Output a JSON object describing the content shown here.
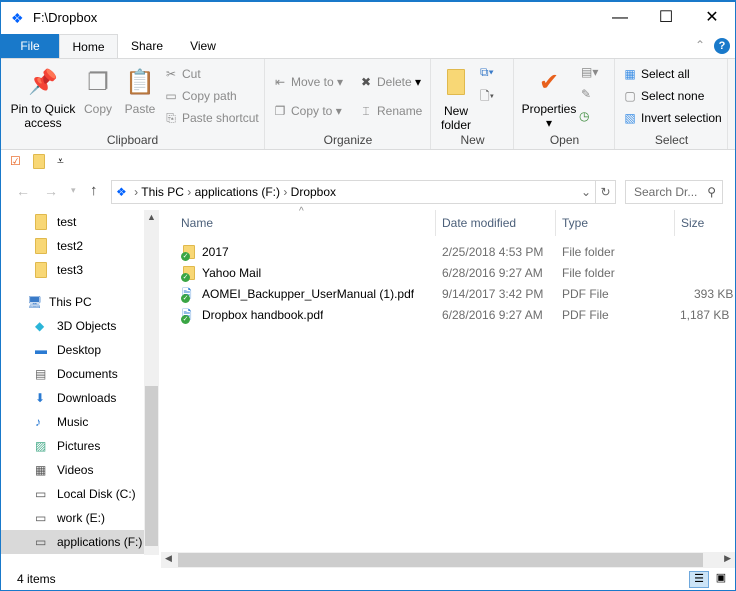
{
  "window": {
    "title": "F:\\Dropbox",
    "minimize": "—",
    "maximize": "☐",
    "close": "✕"
  },
  "tabs": [
    "File",
    "Home",
    "Share",
    "View"
  ],
  "ribbon": {
    "clipboard": {
      "label": "Clipboard",
      "pin": "Pin to Quick access",
      "copy": "Copy",
      "paste": "Paste",
      "cut": "Cut",
      "copy_path": "Copy path",
      "paste_shortcut": "Paste shortcut"
    },
    "organize": {
      "label": "Organize",
      "move_to": "Move to",
      "copy_to": "Copy to",
      "delete": "Delete",
      "rename": "Rename"
    },
    "new": {
      "label": "New",
      "new_folder": "New folder"
    },
    "open": {
      "label": "Open",
      "properties": "Properties"
    },
    "select": {
      "label": "Select",
      "select_all": "Select all",
      "select_none": "Select none",
      "invert": "Invert selection"
    }
  },
  "address": {
    "crumbs": [
      "This PC",
      "applications (F:)",
      "Dropbox"
    ],
    "search_placeholder": "Search Dr..."
  },
  "nav": {
    "items": [
      {
        "label": "test",
        "icon": "folder"
      },
      {
        "label": "test2",
        "icon": "folder"
      },
      {
        "label": "test3",
        "icon": "folder"
      },
      {
        "label": "This PC",
        "icon": "pc"
      },
      {
        "label": "3D Objects",
        "icon": "cube"
      },
      {
        "label": "Desktop",
        "icon": "desktop"
      },
      {
        "label": "Documents",
        "icon": "doc"
      },
      {
        "label": "Downloads",
        "icon": "download"
      },
      {
        "label": "Music",
        "icon": "music"
      },
      {
        "label": "Pictures",
        "icon": "pictures"
      },
      {
        "label": "Videos",
        "icon": "video"
      },
      {
        "label": "Local Disk (C:)",
        "icon": "drive"
      },
      {
        "label": "work (E:)",
        "icon": "drive"
      },
      {
        "label": "applications (F:)",
        "icon": "drive"
      }
    ]
  },
  "columns": [
    "Name",
    "Date modified",
    "Type",
    "Size"
  ],
  "files": [
    {
      "name": "2017",
      "date": "2/25/2018 4:53 PM",
      "type": "File folder",
      "size": "",
      "icon": "folder"
    },
    {
      "name": "Yahoo Mail",
      "date": "6/28/2016 9:27 AM",
      "type": "File folder",
      "size": "",
      "icon": "folder"
    },
    {
      "name": "AOMEI_Backupper_UserManual (1).pdf",
      "date": "9/14/2017 3:42 PM",
      "type": "PDF File",
      "size": "393 KB",
      "icon": "pdf"
    },
    {
      "name": "Dropbox handbook.pdf",
      "date": "6/28/2016 9:27 AM",
      "type": "PDF File",
      "size": "1,187 KB",
      "icon": "pdf"
    }
  ],
  "status": {
    "count": "4 items"
  }
}
